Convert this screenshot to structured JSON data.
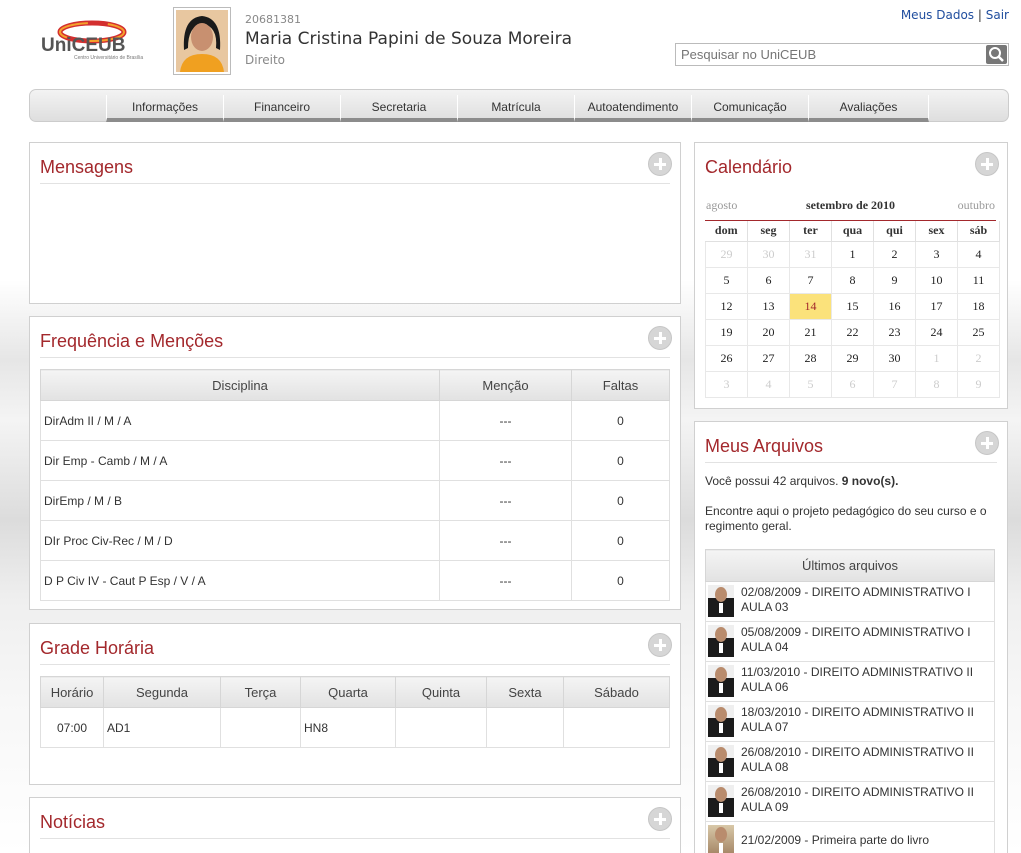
{
  "header": {
    "logo_text": "UniCEUB",
    "logo_subtext": "Centro Universitário de Brasília",
    "student_id": "20681381",
    "student_name": "Maria Cristina Papini de Souza Moreira",
    "course": "Direito",
    "link_my_data": "Meus Dados",
    "link_separator": "|",
    "link_logout": "Sair",
    "search_placeholder": "Pesquisar no UniCEUB"
  },
  "nav": {
    "items": [
      "Informações",
      "Financeiro",
      "Secretaria",
      "Matrícula",
      "Autoatendimento",
      "Comunicação",
      "Avaliações"
    ]
  },
  "mensagens": {
    "title": "Mensagens"
  },
  "frequencia": {
    "title": "Frequência e Menções",
    "columns": [
      "Disciplina",
      "Menção",
      "Faltas"
    ],
    "rows": [
      {
        "disciplina": "DirAdm II / M / A",
        "mencao": "---",
        "faltas": "0"
      },
      {
        "disciplina": "Dir Emp - Camb / M / A",
        "mencao": "---",
        "faltas": "0"
      },
      {
        "disciplina": "DirEmp / M / B",
        "mencao": "---",
        "faltas": "0"
      },
      {
        "disciplina": "DIr Proc Civ-Rec / M / D",
        "mencao": "---",
        "faltas": "0"
      },
      {
        "disciplina": "D P Civ IV - Caut P Esp / V / A",
        "mencao": "---",
        "faltas": "0"
      }
    ]
  },
  "grade": {
    "title": "Grade Horária",
    "columns": [
      "Horário",
      "Segunda",
      "Terça",
      "Quarta",
      "Quinta",
      "Sexta",
      "Sábado"
    ],
    "rows": [
      [
        "07:00",
        "AD1",
        "",
        "HN8",
        "",
        "",
        ""
      ]
    ]
  },
  "noticias": {
    "title": "Notícias"
  },
  "calendario": {
    "title": "Calendário",
    "prev_month": "agosto",
    "current_month": "setembro de 2010",
    "next_month": "outubro",
    "weekdays": [
      "dom",
      "seg",
      "ter",
      "qua",
      "qui",
      "sex",
      "sáb"
    ],
    "weeks": [
      [
        "29",
        "30",
        "31",
        "1",
        "2",
        "3",
        "4"
      ],
      [
        "5",
        "6",
        "7",
        "8",
        "9",
        "10",
        "11"
      ],
      [
        "12",
        "13",
        "14",
        "15",
        "16",
        "17",
        "18"
      ],
      [
        "19",
        "20",
        "21",
        "22",
        "23",
        "24",
        "25"
      ],
      [
        "26",
        "27",
        "28",
        "29",
        "30",
        "1",
        "2"
      ],
      [
        "3",
        "4",
        "5",
        "6",
        "7",
        "8",
        "9"
      ]
    ],
    "today": "14",
    "accent_color": "#a3282c",
    "today_color": "#fbe27b"
  },
  "arquivos": {
    "title": "Meus Arquivos",
    "summary_prefix": "Você possui 42 arquivos.",
    "summary_new": "9 novo(s).",
    "info_text": "Encontre aqui o projeto pedagógico do seu curso e o regimento geral.",
    "table_header": "Últimos arquivos",
    "files": [
      {
        "label": "02/08/2009 - DIREITO ADMINISTRATIVO I AULA 03",
        "icon": "teacher-avatar"
      },
      {
        "label": "05/08/2009 - DIREITO ADMINISTRATIVO I AULA 04",
        "icon": "teacher-avatar"
      },
      {
        "label": "11/03/2010 - DIREITO ADMINISTRATIVO II AULA 06",
        "icon": "teacher-avatar"
      },
      {
        "label": "18/03/2010 - DIREITO ADMINISTRATIVO II AULA 07",
        "icon": "teacher-avatar"
      },
      {
        "label": "26/08/2010 - DIREITO ADMINISTRATIVO II AULA 08",
        "icon": "teacher-avatar"
      },
      {
        "label": "26/08/2010 - DIREITO ADMINISTRATIVO II AULA 09",
        "icon": "teacher-avatar"
      },
      {
        "label": "21/02/2009 - Primeira parte do livro",
        "icon": "teacher-avatar-alt"
      }
    ]
  },
  "colors": {
    "brand_red": "#a3282c",
    "link_blue": "#1f4d9e",
    "logo_orange": "#f4a12b"
  }
}
